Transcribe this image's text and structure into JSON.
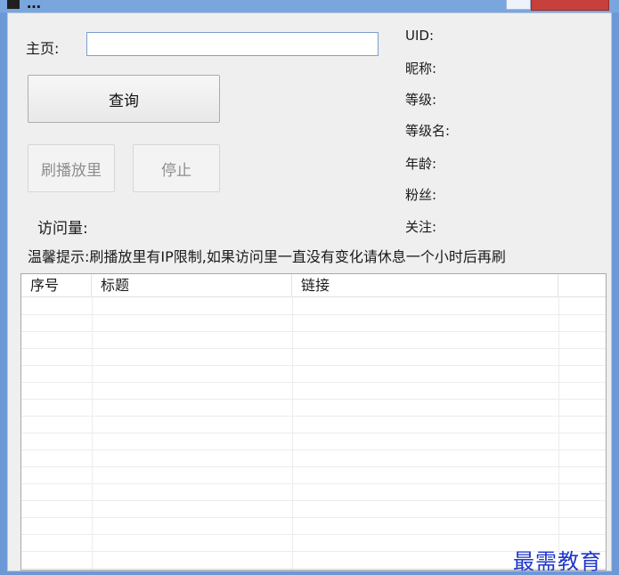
{
  "window": {
    "title": "…",
    "accent_color": "#6c99d6",
    "close_color": "#c7403b"
  },
  "form": {
    "homepage_label": "主页:",
    "homepage_value": "",
    "query_button": "查询",
    "brush_button": "刷播放里",
    "stop_button": "停止",
    "visits_label": "访问量:",
    "visits_value": ""
  },
  "info": {
    "uid": "UID:",
    "nickname": "昵称:",
    "level": "等级:",
    "level_name": "等级名:",
    "age": "年龄:",
    "fans": "粉丝:",
    "follow": "关注:"
  },
  "tip": "温馨提示:刷播放里有IP限制,如果访问里一直没有变化请休息一个小时后再刷",
  "table": {
    "columns": [
      "序号",
      "标题",
      "链接",
      ""
    ],
    "rows": []
  },
  "watermark": "最需教育"
}
